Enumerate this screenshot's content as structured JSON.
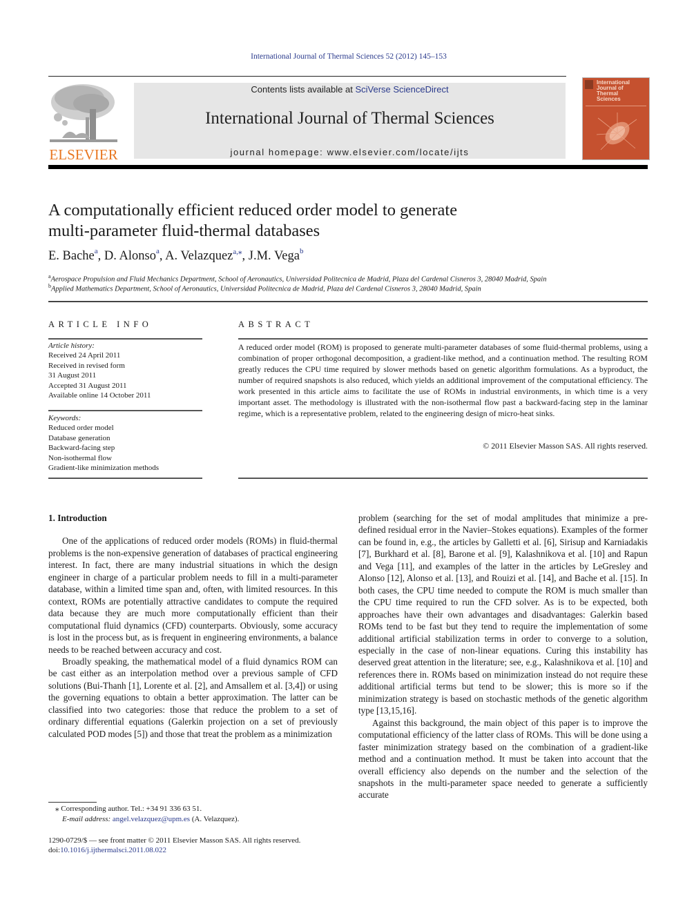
{
  "citation": "International Journal of Thermal Sciences 52 (2012) 145–153",
  "header": {
    "publisher_logo_text": "ELSEVIER",
    "contents_prefix": "Contents lists available at ",
    "contents_link": "SciVerse ScienceDirect",
    "journal_name": "International Journal of Thermal Sciences",
    "homepage": "journal homepage: www.elsevier.com/locate/ijts",
    "cover_title_lines": [
      "International",
      "Journal of",
      "Thermal",
      "Sciences"
    ],
    "colors": {
      "logo_orange": "#e87722",
      "banner_gray": "#e6e6e6",
      "cover_red": "#c5512f",
      "link_blue": "#2a3a8c"
    }
  },
  "article": {
    "title_line1": "A computationally efficient reduced order model to generate",
    "title_line2": "multi-parameter fluid-thermal databases",
    "authors": [
      {
        "name": "E. Bache",
        "sup": "a"
      },
      {
        "name": "D. Alonso",
        "sup": "a"
      },
      {
        "name": "A. Velazquez",
        "sup": "a,⁎"
      },
      {
        "name": "J.M. Vega",
        "sup": "b"
      }
    ],
    "affiliations": [
      {
        "mark": "a",
        "text": "Aerospace Propulsion and Fluid Mechanics Department, School of Aeronautics, Universidad Politecnica de Madrid, Plaza del Cardenal Cisneros 3, 28040 Madrid, Spain"
      },
      {
        "mark": "b",
        "text": "Applied Mathematics Department, School of Aeronautics, Universidad Politecnica de Madrid, Plaza del Cardenal Cisneros 3, 28040 Madrid, Spain"
      }
    ]
  },
  "article_info": {
    "heading": "ARTICLE INFO",
    "history_label": "Article history:",
    "history": [
      "Received 24 April 2011",
      "Received in revised form",
      "31 August 2011",
      "Accepted 31 August 2011",
      "Available online 14 October 2011"
    ],
    "keywords_label": "Keywords:",
    "keywords": [
      "Reduced order model",
      "Database generation",
      "Backward-facing step",
      "Non-isothermal flow",
      "Gradient-like minimization methods"
    ]
  },
  "abstract": {
    "heading": "ABSTRACT",
    "text": "A reduced order model (ROM) is proposed to generate multi-parameter databases of some fluid-thermal problems, using a combination of proper orthogonal decomposition, a gradient-like method, and a continuation method. The resulting ROM greatly reduces the CPU time required by slower methods based on genetic algorithm formulations. As a byproduct, the number of required snapshots is also reduced, which yields an additional improvement of the computational efficiency. The work presented in this article aims to facilitate the use of ROMs in industrial environments, in which time is a very important asset. The methodology is illustrated with the non-isothermal flow past a backward-facing step in the laminar regime, which is a representative problem, related to the engineering design of micro-heat sinks.",
    "copyright": "© 2011 Elsevier Masson SAS. All rights reserved."
  },
  "body": {
    "section_heading": "1.  Introduction",
    "left_paragraphs": [
      "One of the applications of reduced order models (ROMs) in fluid-thermal problems is the non-expensive generation of data­bases of practical engineering interest. In fact, there are many industrial situations in which the design engineer in charge of a particular problem needs to fill in a multi-parameter database, within a limited time span and, often, with limited resources. In this context, ROMs are potentially attractive candidates to compute the required data because they are much more computationally effi­cient than their computational fluid dynamics (CFD) counterparts. Obviously, some accuracy is lost in the process but, as is frequent in engineering environments, a balance needs to be reached between accuracy and cost.",
      "Broadly speaking, the mathematical model of a fluid dynamics ROM can be cast either as an interpolation method over a previous sample of CFD solutions (Bui-Thanh [1], Lorente et al. [2], and Amsallem et al. [3,4]) or using the governing equations to obtain a better approximation. The latter can be classified into two cate­gories: those that reduce the problem to a set of ordinary differential equations (Galerkin projection on a set of previously calculated POD modes [5]) and those that treat the problem as a minimization"
    ],
    "right_paragraphs": [
      "problem (searching for the set of modal amplitudes that minimize a pre-defined residual error in the Navier–Stokes equations). Examples of the former can be found in, e.g., the articles by Galletti et al. [6], Sirisup and Karniadakis [7], Burkhard et al. [8], Barone et al. [9], Kalashnikova et al. [10] and Rapun and Vega [11], and examples of the latter in the articles by LeGresley and Alonso [12], Alonso et al. [13], and Rouizi et al. [14], and Bache et al. [15]. In both cases, the CPU time needed to compute the ROM is much smaller than the CPU time required to run the CFD solver. As is to be expected, both approaches have their own advantages and disadvantages: Galerkin based ROMs tend to be fast but they tend to require the imple­mentation of some additional artificial stabilization terms in order to converge to a solution, especially in the case of non-linear equations. Curing this instability has deserved great attention in the literature; see, e.g., Kalashnikova et al. [10] and references there in. ROMs based on minimization instead do not require these additional artificial terms but tend to be slower; this is more so if the minimization strategy is based on stochastic methods of the genetic algorithm type [13,15,16].",
      "Against this background, the main object of this paper is to improve the computational efficiency of the latter class of ROMs. This will be done using a faster minimization strategy based on the combination of a gradient-like method and a continuation method. It must be taken into account that the overall efficiency also depends on the number and the selection of the snapshots in the multi-parameter space needed to generate a sufficiently accurate"
    ]
  },
  "footnotes": {
    "corresponding": "⁎  Corresponding author. Tel.: +34 91 336 63 51.",
    "email_label": "E-mail address: ",
    "email": "angel.velazquez@upm.es",
    "email_suffix": " (A. Velazquez).",
    "issn_line": "1290-0729/$ — see front matter © 2011 Elsevier Masson SAS. All rights reserved.",
    "doi_label": "doi:",
    "doi": "10.1016/j.ijthermalsci.2011.08.022"
  }
}
